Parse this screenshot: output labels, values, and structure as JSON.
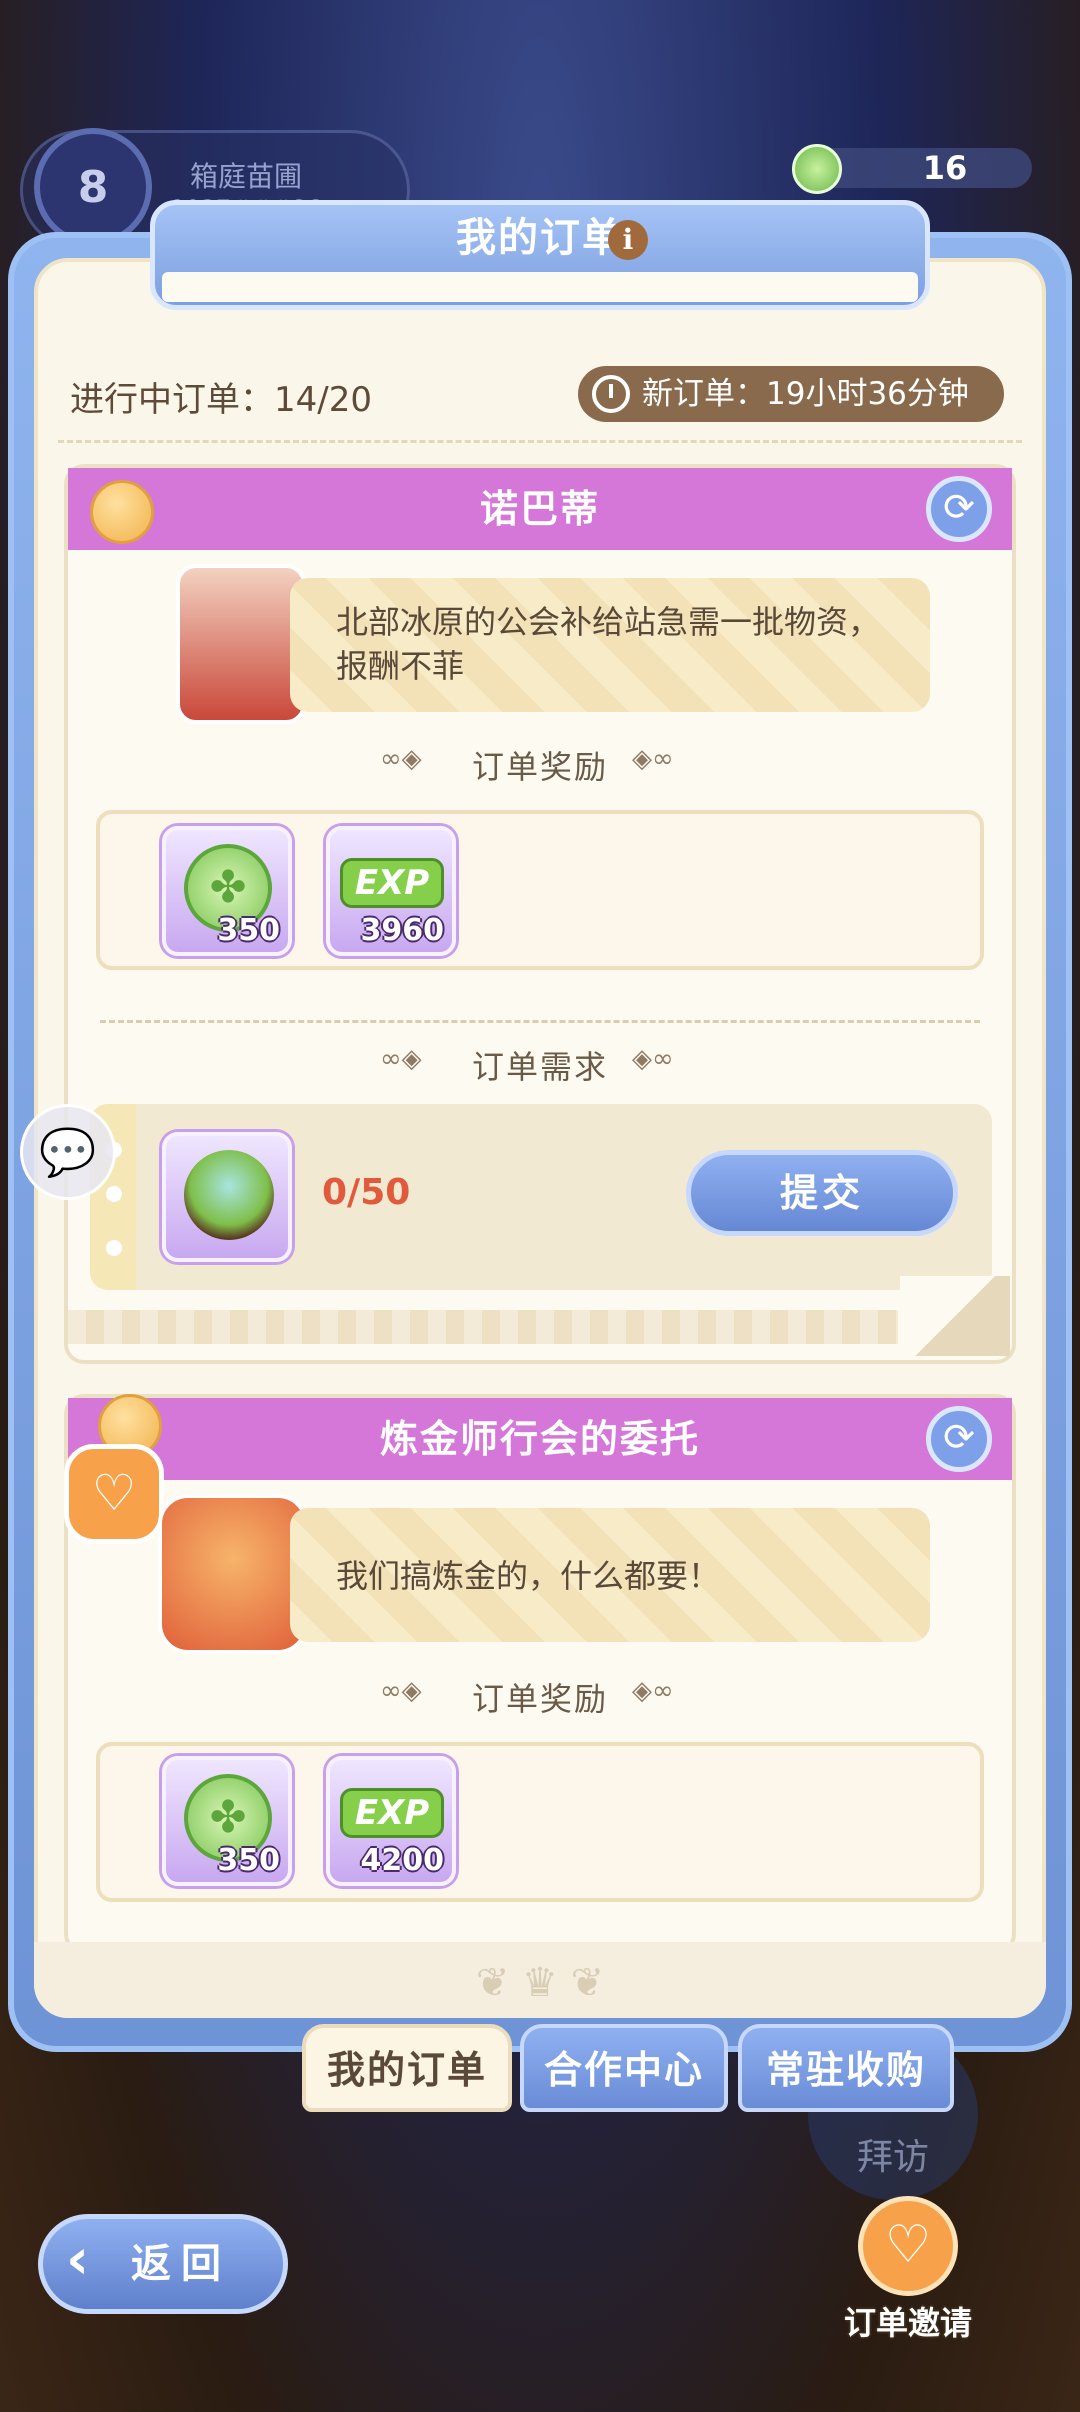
{
  "player": {
    "level": "8",
    "name": "箱庭苗圃",
    "id": "9037###86"
  },
  "currency": {
    "icon": "clover-coin-icon",
    "value": "16"
  },
  "panel": {
    "title": "我的订单"
  },
  "status": {
    "ongoing": "进行中订单：14/20",
    "new_order": "新订单：19小时36分钟"
  },
  "orders": [
    {
      "name": "诺巴蒂",
      "message": "北部冰原的公会补给站急需一批物资，报酬不菲",
      "reward_title": "订单奖励",
      "rewards": [
        {
          "icon": "clover-coin-icon",
          "amount": "350"
        },
        {
          "icon": "exp-clover-icon",
          "label": "EXP",
          "amount": "3960"
        }
      ],
      "requirement_title": "订单需求",
      "requirement": {
        "icon": "salad-bowl-icon",
        "progress": "0/50"
      },
      "submit_label": "提交"
    },
    {
      "name": "炼金师行会的委托",
      "message": "我们搞炼金的，什么都要！",
      "reward_title": "订单奖励",
      "rewards": [
        {
          "icon": "clover-coin-icon",
          "amount": "350"
        },
        {
          "icon": "exp-clover-icon",
          "label": "EXP",
          "amount": "4200"
        }
      ]
    }
  ],
  "tabs": [
    {
      "label": "我的订单"
    },
    {
      "label": "合作中心"
    },
    {
      "label": "常驻收购"
    }
  ],
  "visit_label": "拜访",
  "back_label": "返回",
  "invite_label": "订单邀请"
}
